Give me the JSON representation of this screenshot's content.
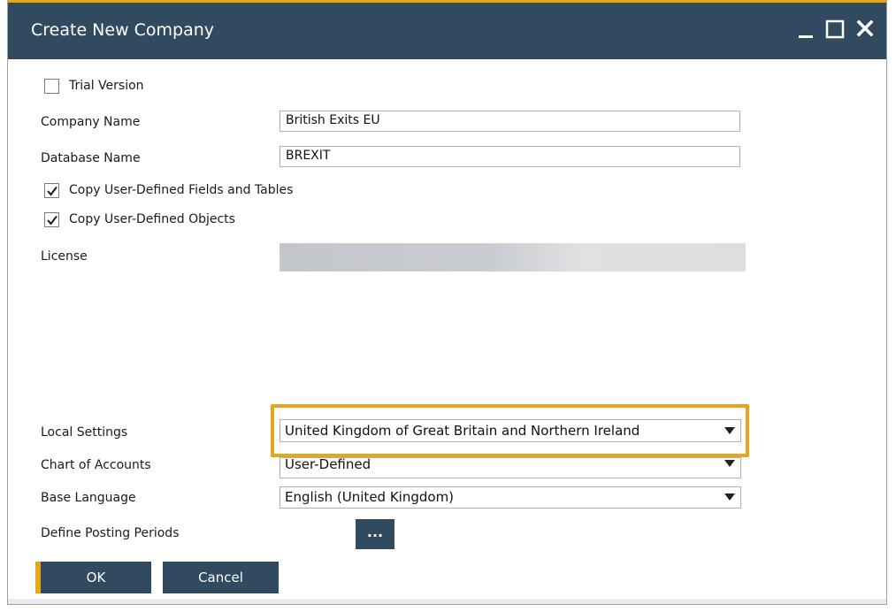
{
  "window": {
    "title": "Create New Company",
    "controls": {
      "minimize": "minimize-icon",
      "maximize": "maximize-icon",
      "close": "close-icon"
    }
  },
  "form": {
    "trial_version": {
      "label": "Trial Version",
      "checked": false
    },
    "company_name": {
      "label": "Company Name",
      "value": "British Exits EU"
    },
    "database_name": {
      "label": "Database Name",
      "value": "BREXIT"
    },
    "copy_udf": {
      "label": "Copy User-Defined Fields and Tables",
      "checked": true
    },
    "copy_udo": {
      "label": "Copy User-Defined Objects",
      "checked": true
    },
    "license": {
      "label": "License"
    },
    "local_settings": {
      "label": "Local Settings",
      "value": "United Kingdom of Great Britain and Northern Ireland"
    },
    "chart_of_accounts": {
      "label": "Chart of Accounts",
      "value": "User-Defined"
    },
    "base_language": {
      "label": "Base Language",
      "value": "English (United Kingdom)"
    },
    "posting_periods": {
      "label": "Define Posting Periods",
      "button": "..."
    }
  },
  "buttons": {
    "ok": "OK",
    "cancel": "Cancel"
  },
  "colors": {
    "titlebar": "#324a5f",
    "accent": "#e6a817",
    "highlight": "#e8a41a"
  }
}
